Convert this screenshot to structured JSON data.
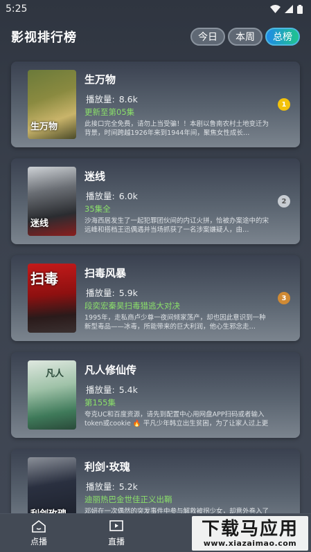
{
  "status_bar": {
    "time": "5:25"
  },
  "header": {
    "title": "影视排行榜",
    "filters": [
      {
        "label": "今日",
        "active": false
      },
      {
        "label": "本周",
        "active": false
      },
      {
        "label": "总榜",
        "active": true
      }
    ]
  },
  "items": [
    {
      "rank": "1",
      "title": "生万物",
      "plays_label": "播放量:",
      "plays": "8.6k",
      "status": "更新至第05集",
      "desc": "此接口完全免费，请勿上当受骗！！本剧以鲁南农村土地变迁为背景，时间跨越1926年来到1944年间，聚焦女性成长…",
      "poster_text": "生万物"
    },
    {
      "rank": "2",
      "title": "迷线",
      "plays_label": "播放量:",
      "plays": "6.0k",
      "status": "35集全",
      "desc": "沙海西居发生了一起犯罪团伙间的内讧火拼，恰被办案途中的宋远峰和搭档王迅偶遇并当场抓获了一名涉案嫌疑人，由…",
      "poster_text": "迷线"
    },
    {
      "rank": "3",
      "title": "扫毒风暴",
      "plays_label": "播放量:",
      "plays": "5.9k",
      "status": "段奕宏秦昊扫毒猎逃大对决",
      "desc": "1995年，走私商卢少尊一夜间倾家荡产，却也因此意识到一种新型毒品——冰毒，所能带来的巨大利润，他心生邪念走…",
      "poster_text": "扫毒"
    },
    {
      "rank": "",
      "title": "凡人修仙传",
      "plays_label": "播放量:",
      "plays": "5.4k",
      "status": "第155集",
      "desc": "夸克UC和百度资源，请先到配置中心用网盘APP扫码或者输入token或cookie 🔥 平凡少年韩立出生贫困，为了让家人过上更好的生活，…",
      "poster_text": "凡人"
    },
    {
      "rank": "",
      "title": "利剑·玫瑰",
      "plays_label": "播放量:",
      "plays": "5.2k",
      "status": "迪丽热巴金世佳正义出鞘",
      "desc": "邓妍在一次偶然的突发事件中参与解救被拐少女，却意外卷入了拐卖团伙…",
      "poster_text": "利剑玫瑰"
    }
  ],
  "tabbar": [
    {
      "label": "点播",
      "icon": "home-icon"
    },
    {
      "label": "直播",
      "icon": "live-tv-icon"
    }
  ],
  "watermark": {
    "line1": "下载马应用",
    "line2": "www.xiazaimao.com"
  },
  "colors": {
    "accent_green": "#8be06a",
    "rank_gold": "#f3c20b",
    "rank_silver": "#c7ccd2",
    "rank_bronze": "#d08a34"
  }
}
